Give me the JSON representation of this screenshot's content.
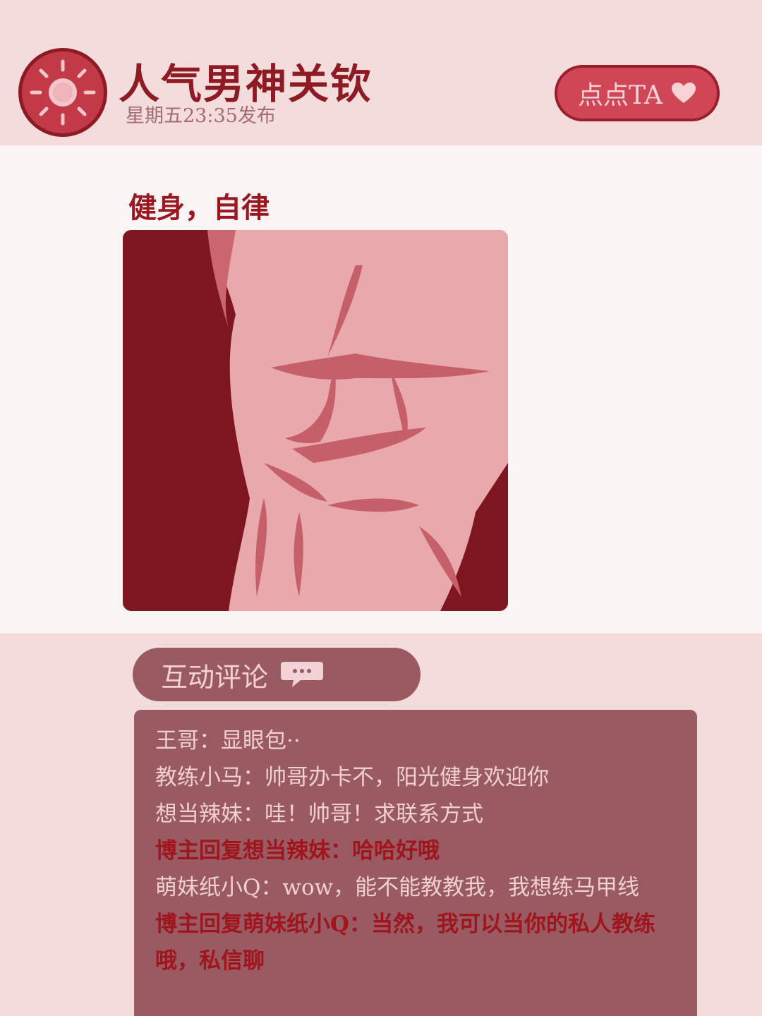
{
  "header": {
    "avatar_icon": "sun-icon",
    "name": "人气男神关钦",
    "time": "星期五23:35发布",
    "like_label": "点点TA",
    "like_icon": "heart-icon"
  },
  "post": {
    "title": "健身，自律",
    "image_icon": "abs-photo"
  },
  "comments_section": {
    "label": "互动评论",
    "icon": "chat-bubble-icon",
    "items": [
      {
        "text": "王哥：显眼包··"
      },
      {
        "text": "教练小马：帅哥办卡不，阳光健身欢迎你"
      },
      {
        "text": "想当辣妹：哇！帅哥！求联系方式"
      },
      {
        "text": "博主回复想当辣妹：哈哈好哦"
      },
      {
        "text": "萌妹纸小Q：wow，能不能教教我，我想练马甲线"
      },
      {
        "text": "博主回复萌妹纸小Q：当然，我可以当你的私人教练哦，私信聊"
      }
    ]
  },
  "colors": {
    "accent": "#c23a48",
    "dark_red": "#8e1a24",
    "panel": "#9a5a62",
    "background": "#f4dcdc"
  }
}
